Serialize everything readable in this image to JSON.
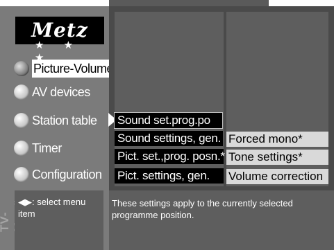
{
  "brand": {
    "logo": "Metz",
    "stars": "★ ★ ★"
  },
  "side_label": "TV-Menü",
  "menu": {
    "items": [
      {
        "label": "Picture-Volume",
        "active": true
      },
      {
        "label": "AV devices"
      },
      {
        "label": "Station table"
      },
      {
        "label": "Timer"
      },
      {
        "label": "Configuration"
      }
    ]
  },
  "submenu": {
    "left": [
      "Sound set.prog.po",
      "Sound settings, gen.",
      "Pict. set.,prog. posn.*",
      "Pict. settings, gen."
    ],
    "right": [
      "Forced mono*",
      "Tone settings*",
      "Volume correction"
    ]
  },
  "help": {
    "keys": "◀▶",
    "text": ": select menu item"
  },
  "description": "These settings apply to the currently selected programme position.",
  "colors": {
    "sidebar": "#7b7b7b",
    "panel": "#5e5e5e",
    "selected": "#ffffff",
    "option_light": "#d9d9d9"
  }
}
